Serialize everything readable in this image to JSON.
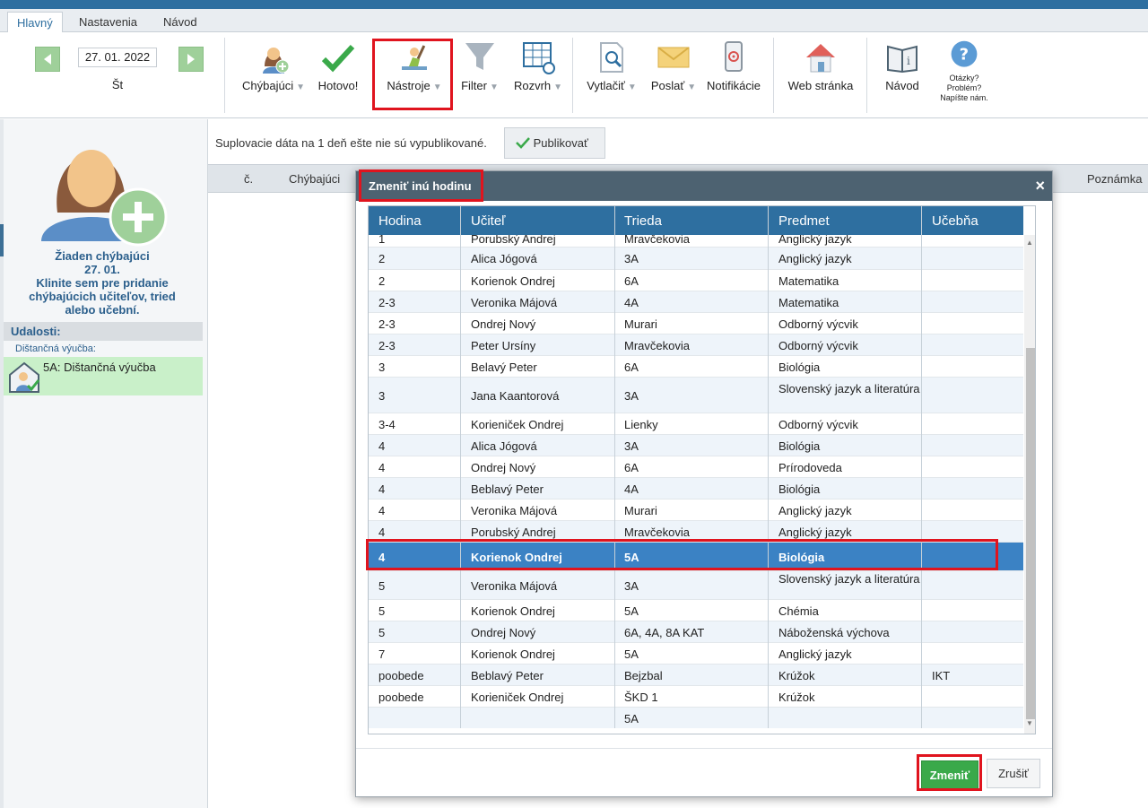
{
  "tabs": [
    {
      "label": "Hlavný"
    },
    {
      "label": "Nastavenia"
    },
    {
      "label": "Návod"
    }
  ],
  "date_nav": {
    "date": "27. 01. 2022",
    "day": "Št"
  },
  "toolbar": {
    "absent": "Chýbajúci",
    "done": "Hotovo!",
    "tools": "Nástroje",
    "filter": "Filter",
    "schedule": "Rozvrh",
    "print": "Vytlačiť",
    "send": "Poslať",
    "notifications": "Notifikácie",
    "website": "Web stránka",
    "guide": "Návod",
    "help_line1": "Otázky?",
    "help_line2": "Problém?",
    "help_line3": "Napíšte nám."
  },
  "left_pane": {
    "no_absent_line1": "Žiaden chýbajúci",
    "no_absent_line2": "27. 01.",
    "no_absent_line3": "Klinite sem pre pridanie",
    "no_absent_line4": "chýbajúcich učiteľov, tried",
    "no_absent_line5": "alebo učební.",
    "events_title": "Udalosti:",
    "events_sub": "Dištančná výučba:",
    "event_item": "5A: Dištančná výučba"
  },
  "main": {
    "notice": "Suplovacie dáta na 1 deň ešte nie sú vypublikované.",
    "publish_label": "Publikovať",
    "grid_cols": {
      "no": "č.",
      "absent": "Chýbajúci",
      "note": "Poznámka"
    }
  },
  "modal": {
    "title": "Zmeniť inú hodinu",
    "close_label": "×",
    "columns": [
      "Hodina",
      "Učiteľ",
      "Trieda",
      "Predmet",
      "Učebňa"
    ],
    "rows": [
      {
        "hodina": "1",
        "ucitel": "Porubský Andrej",
        "trieda": "Mravčekovia",
        "predmet": "Anglický jazyk",
        "ucebna": ""
      },
      {
        "hodina": "2",
        "ucitel": "Alica Jógová",
        "trieda": "3A",
        "predmet": "Anglický jazyk",
        "ucebna": ""
      },
      {
        "hodina": "2",
        "ucitel": "Korienok Ondrej",
        "trieda": "6A",
        "predmet": "Matematika",
        "ucebna": ""
      },
      {
        "hodina": "2-3",
        "ucitel": "Veronika Májová",
        "trieda": "4A",
        "predmet": "Matematika",
        "ucebna": ""
      },
      {
        "hodina": "2-3",
        "ucitel": "Ondrej Nový",
        "trieda": "Murari",
        "predmet": "Odborný výcvik",
        "ucebna": ""
      },
      {
        "hodina": "2-3",
        "ucitel": "Peter Ursíny",
        "trieda": "Mravčekovia",
        "predmet": "Odborný výcvik",
        "ucebna": ""
      },
      {
        "hodina": "3",
        "ucitel": "Belavý Peter",
        "trieda": "6A",
        "predmet": "Biológia",
        "ucebna": ""
      },
      {
        "hodina": "3",
        "ucitel": "Jana Kaantorová",
        "trieda": "3A",
        "predmet": "Slovenský jazyk a literatúra",
        "ucebna": ""
      },
      {
        "hodina": "3-4",
        "ucitel": "Korieniček Ondrej",
        "trieda": "Lienky",
        "predmet": "Odborný výcvik",
        "ucebna": ""
      },
      {
        "hodina": "4",
        "ucitel": "Alica Jógová",
        "trieda": "3A",
        "predmet": "Biológia",
        "ucebna": ""
      },
      {
        "hodina": "4",
        "ucitel": "Ondrej Nový",
        "trieda": "6A",
        "predmet": "Prírodoveda",
        "ucebna": ""
      },
      {
        "hodina": "4",
        "ucitel": "Beblavý Peter",
        "trieda": "4A",
        "predmet": "Biológia",
        "ucebna": ""
      },
      {
        "hodina": "4",
        "ucitel": "Veronika Májová",
        "trieda": "Murari",
        "predmet": "Anglický jazyk",
        "ucebna": ""
      },
      {
        "hodina": "4",
        "ucitel": "Porubský Andrej",
        "trieda": "Mravčekovia",
        "predmet": "Anglický jazyk",
        "ucebna": ""
      },
      {
        "hodina": "4",
        "ucitel": "Korienok Ondrej",
        "trieda": "5A",
        "predmet": "Biológia",
        "ucebna": "",
        "selected": true
      },
      {
        "hodina": "5",
        "ucitel": "Veronika Májová",
        "trieda": "3A",
        "predmet": "Slovenský jazyk a literatúra",
        "ucebna": ""
      },
      {
        "hodina": "5",
        "ucitel": "Korienok Ondrej",
        "trieda": "5A",
        "predmet": "Chémia",
        "ucebna": ""
      },
      {
        "hodina": "5",
        "ucitel": "Ondrej Nový",
        "trieda": "6A, 4A, 8A KAT",
        "predmet": "Náboženská výchova",
        "ucebna": ""
      },
      {
        "hodina": "7",
        "ucitel": "Korienok Ondrej",
        "trieda": "5A",
        "predmet": "Anglický jazyk",
        "ucebna": ""
      },
      {
        "hodina": "poobede",
        "ucitel": "Beblavý Peter",
        "trieda": "Bejzbal",
        "predmet": "Krúžok",
        "ucebna": "IKT"
      },
      {
        "hodina": "poobede",
        "ucitel": "Korieniček Ondrej",
        "trieda": "ŠKD 1",
        "predmet": "Krúžok",
        "ucebna": ""
      },
      {
        "hodina": "",
        "ucitel": "",
        "trieda": "5A",
        "predmet": "",
        "ucebna": ""
      }
    ],
    "confirm_label": "Zmeniť",
    "cancel_label": "Zrušiť"
  },
  "colors": {
    "accent": "#2e6fa0",
    "header_dark": "#4d6271",
    "selected_row": "#3b82c4",
    "confirm_green": "#3aa94a",
    "highlight_red": "#e0141e",
    "event_green": "#c9f0c9"
  }
}
